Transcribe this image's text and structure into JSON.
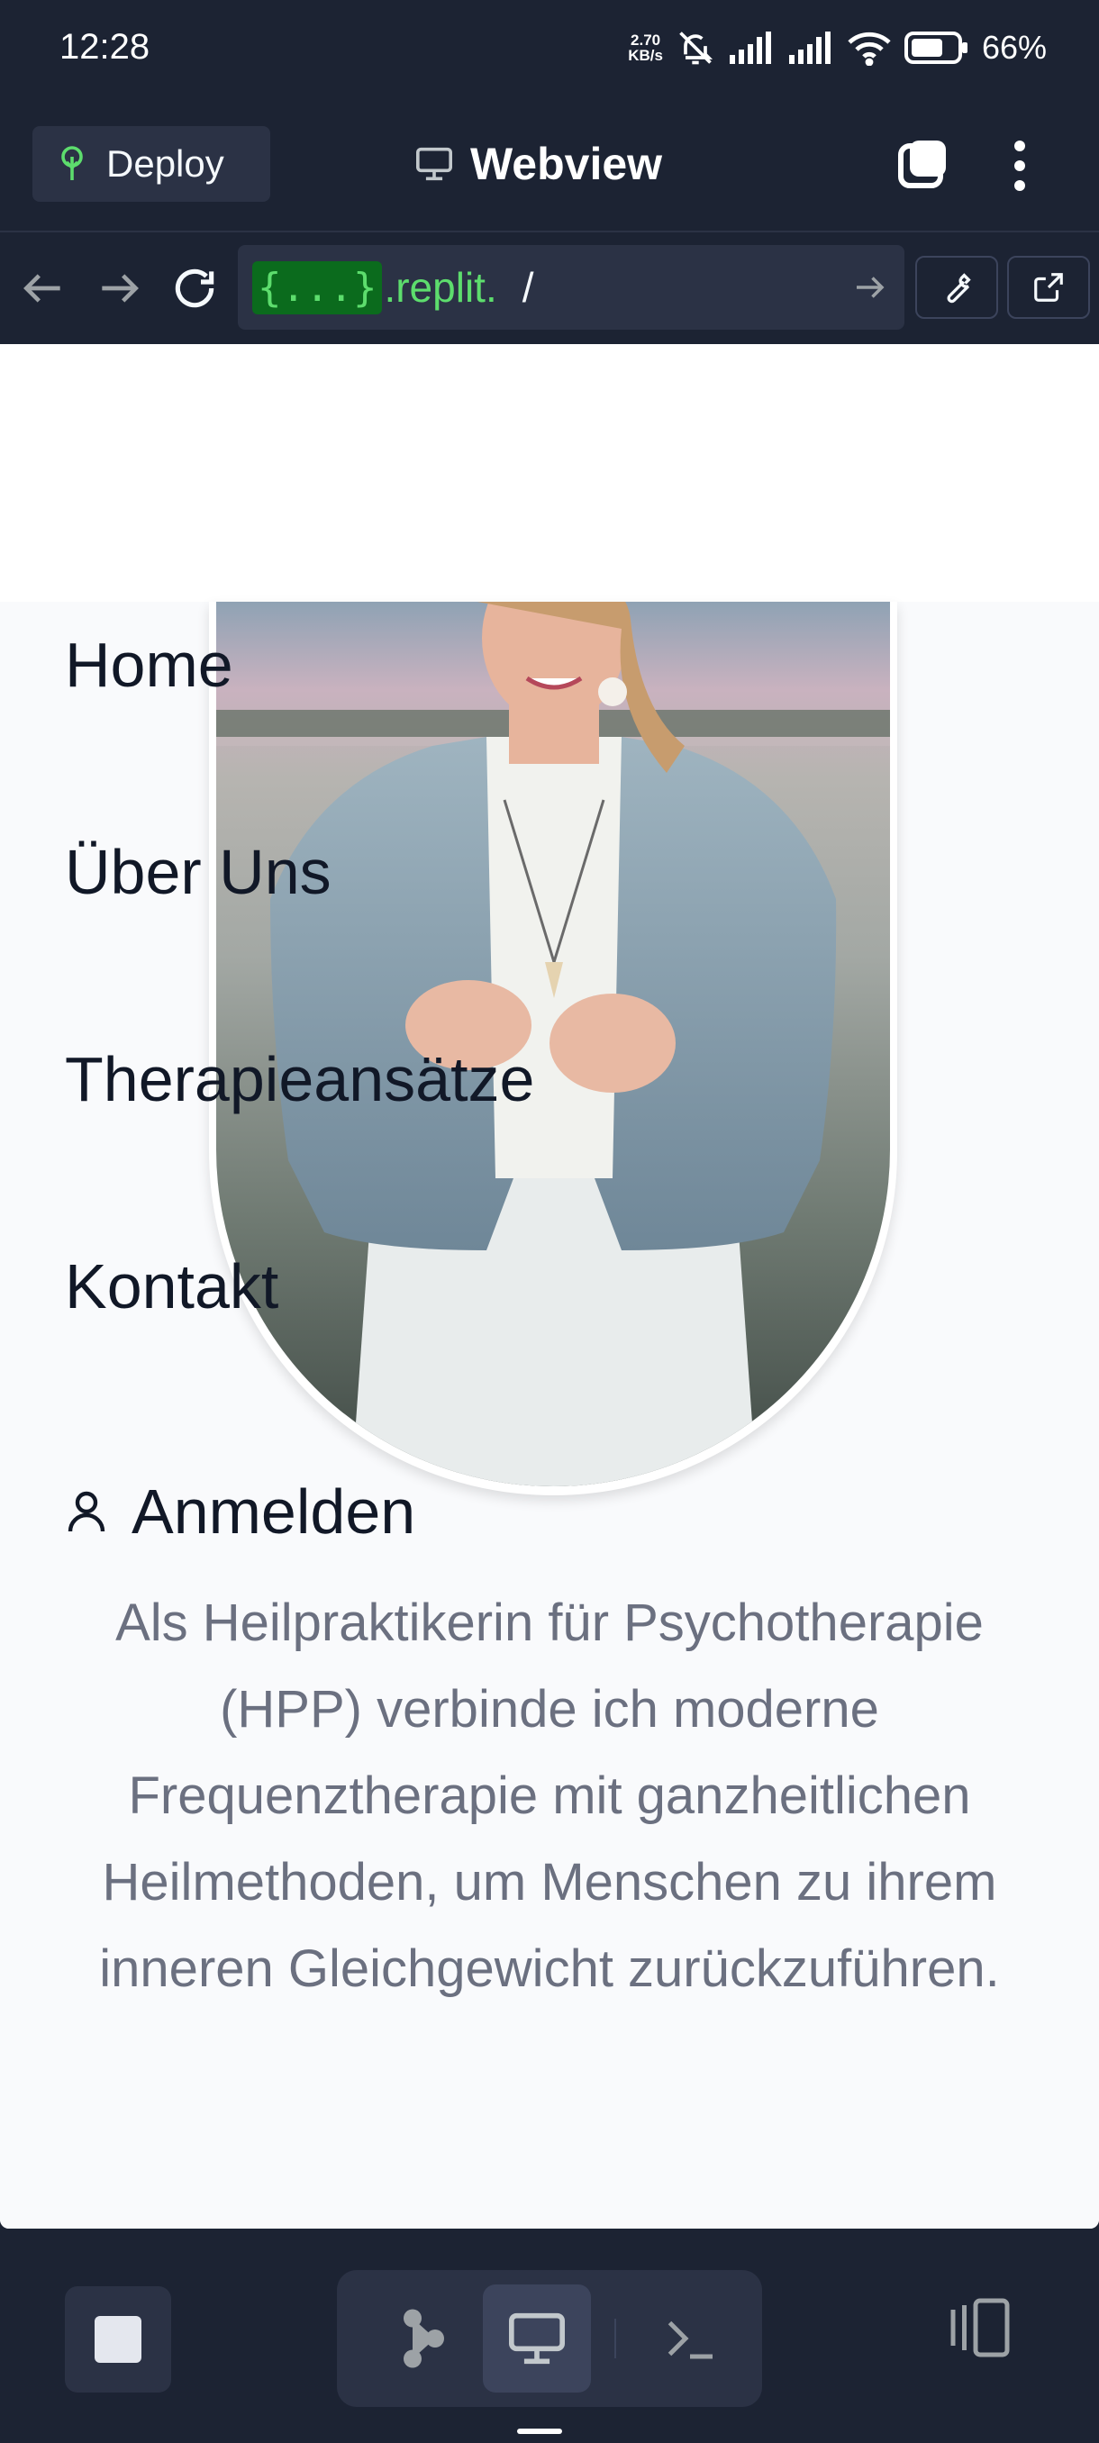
{
  "status_bar": {
    "time": "12:28",
    "net_speed_value": "2.70",
    "net_speed_unit": "KB/s",
    "battery": "66%"
  },
  "header": {
    "deploy_label": "Deploy",
    "title": "Webview"
  },
  "url_bar": {
    "badge": "{...}",
    "host": ".replit.",
    "path": "/"
  },
  "site": {
    "menu": [
      {
        "label": "Home"
      },
      {
        "label": "Über Uns"
      },
      {
        "label": "Therapieansätze"
      },
      {
        "label": "Kontakt"
      }
    ],
    "login_label": "Anmelden",
    "intro": "Als Heilpraktikerin für Psychotherapie (HPP) verbinde ich moderne Frequenztherapie mit ganzheitlichen Heilmethoden, um Menschen zu ihrem inneren Gleichgewicht zurückzuführen."
  },
  "icons": {
    "deploy": "deploy-tree-icon",
    "webview": "monitor-icon",
    "tabs": "tabs-icon",
    "menu": "kebab-icon",
    "back": "arrow-left-icon",
    "forward": "arrow-right-icon",
    "reload": "reload-icon",
    "devtools": "wrench-icon",
    "open_external": "external-link-icon",
    "login": "user-icon"
  },
  "colors": {
    "app_bg": "#1c2333",
    "panel_bg": "#2b3245",
    "url_accent": "#5ddd6d",
    "page_text": "#111827",
    "intro_text": "#6b7080"
  }
}
